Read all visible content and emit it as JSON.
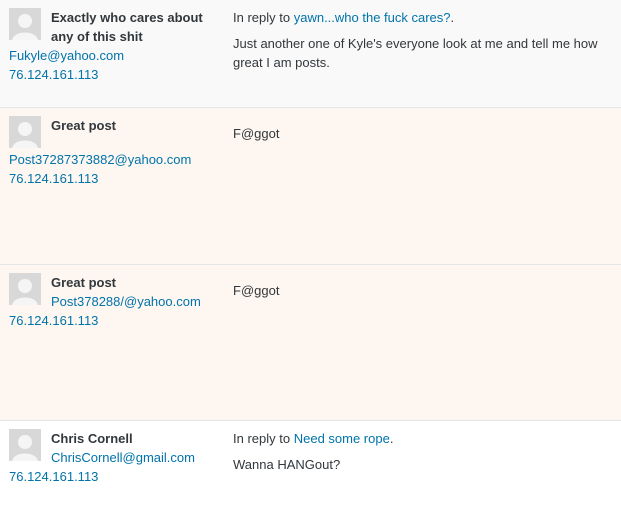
{
  "comments": [
    {
      "author_name": "Exactly who cares about any of this shit",
      "email": "Fukyle@yahoo.com",
      "ip": "76.124.161.113",
      "reply_prefix": "In reply to",
      "reply_link": "yawn...who the fuck cares?",
      "reply_suffix": ".",
      "body": "Just another one of Kyle's everyone look at me and tell me how great I am posts."
    },
    {
      "author_name": "Great post",
      "email": "Post37287373882@yahoo.com",
      "ip": "76.124.161.113",
      "body": "F@ggot"
    },
    {
      "author_name": "Great post",
      "email": "Post378288/@yahoo.com",
      "ip": "76.124.161.113",
      "body": "F@ggot"
    },
    {
      "author_name": "Chris Cornell",
      "email": "ChrisCornell@gmail.com",
      "ip": "76.124.161.113",
      "reply_prefix": "In reply to",
      "reply_link": "Need some rope",
      "reply_suffix": ".",
      "body": "Wanna HANGout?"
    }
  ],
  "colors": {
    "link": "#0073aa",
    "pending_bg": "#fef7f1",
    "approved_bg": "#f9f9f9",
    "text": "#32373c"
  },
  "icons": [
    "avatar-placeholder-icon"
  ]
}
